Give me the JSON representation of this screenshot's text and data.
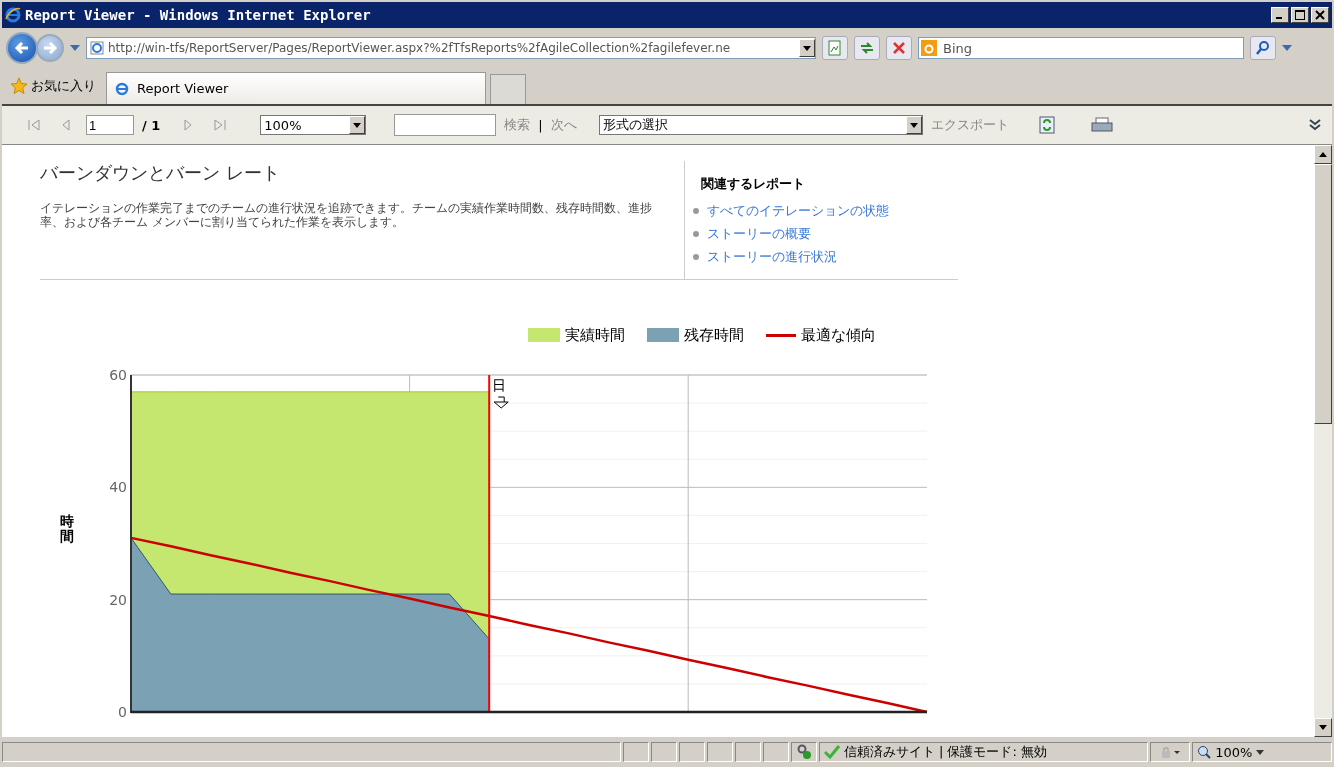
{
  "window": {
    "title": "Report Viewer - Windows Internet Explorer"
  },
  "address_bar": {
    "url": "http://win-tfs/ReportServer/Pages/ReportViewer.aspx?%2fTfsReports%2fAgileCollection%2fagilefever.ne"
  },
  "search": {
    "provider": "Bing"
  },
  "favorites": {
    "label": "お気に入り"
  },
  "tabs": [
    {
      "label": "Report Viewer",
      "selected": true
    }
  ],
  "report_toolbar": {
    "page": "1",
    "page_total": "/ 1",
    "zoom": "100%",
    "find_label": "検索",
    "separator": "|",
    "next_label": "次へ",
    "format": "形式の選択",
    "export_label": "エクスポート"
  },
  "report": {
    "title": "バーンダウンとバーン レート",
    "description": "イテレーションの作業完了までのチームの進行状況を追跡できます。チームの実績作業時間数、残存時間数、進捗率、および各チーム メンバーに割り当てられた作業を表示します。",
    "related_title": "関連するレポート",
    "related_links": [
      "すべてのイテレーションの状態",
      "ストーリーの概要",
      "ストーリーの進行状況"
    ],
    "today_marker": "日",
    "chart_data": {
      "type": "area",
      "ylabel": "時間",
      "categories": [
        null,
        null,
        null,
        null,
        null,
        null,
        null,
        null,
        null,
        null,
        null,
        null,
        null,
        null,
        null,
        null,
        null,
        null,
        null,
        null,
        null
      ],
      "ylim": [
        0,
        60
      ],
      "yticks": [
        0,
        20,
        40,
        60
      ],
      "stacked": false,
      "grid": true,
      "series": [
        {
          "name": "実績時間",
          "color": "#c5e66f",
          "values": [
            57,
            57,
            57,
            57,
            57,
            57,
            57,
            57,
            57,
            57,
            null,
            null,
            null,
            null,
            null,
            null,
            null,
            null,
            null,
            null,
            null
          ]
        },
        {
          "name": "残存時間",
          "color": "#7ba1b5",
          "values": [
            31,
            21,
            21,
            21,
            21,
            21,
            21,
            21,
            21,
            13,
            null,
            null,
            null,
            null,
            null,
            null,
            null,
            null,
            null,
            null,
            null
          ]
        },
        {
          "name": "最適な傾向",
          "type": "line",
          "color": "#cc0000",
          "values": [
            31,
            29.5,
            27.9,
            26.4,
            24.8,
            23.3,
            21.7,
            20.2,
            18.6,
            17.1,
            15.5,
            14,
            12.4,
            10.9,
            9.3,
            7.8,
            6.2,
            4.7,
            3.1,
            1.6,
            0
          ]
        }
      ]
    }
  },
  "status_bar": {
    "zone": "信頼済みサイト | 保護モード: 無効",
    "zoom": "100%"
  }
}
